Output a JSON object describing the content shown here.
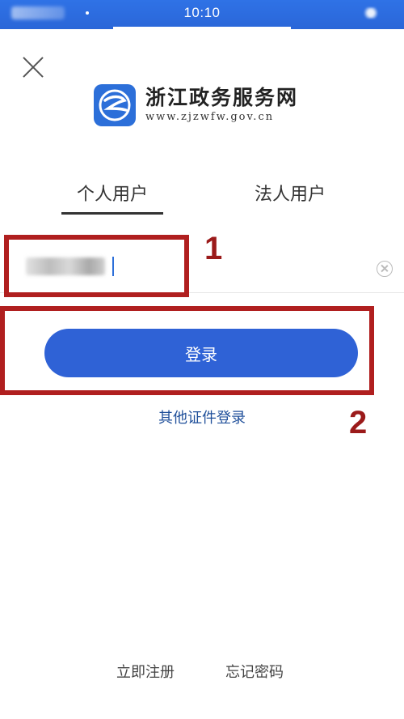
{
  "status_bar": {
    "time": "10:10"
  },
  "header": {
    "close_icon": "close-icon",
    "logo_title": "浙江政务服务网",
    "logo_url": "www.zjzwfw.gov.cn"
  },
  "tabs": [
    {
      "label": "个人用户",
      "active": true
    },
    {
      "label": "法人用户",
      "active": false
    }
  ],
  "form": {
    "id_input_value": "",
    "login_label": "登录",
    "other_login_label": "其他证件登录"
  },
  "annotations": [
    {
      "number": "1",
      "color": "#b01f1f"
    },
    {
      "number": "2",
      "color": "#b01f1f"
    }
  ],
  "footer": {
    "register_label": "立即注册",
    "forgot_label": "忘记密码"
  },
  "colors": {
    "status_bar": "#2f72e6",
    "primary_button": "#2f62d6",
    "link": "#1f4f9a",
    "annotation": "#b01f1f"
  }
}
